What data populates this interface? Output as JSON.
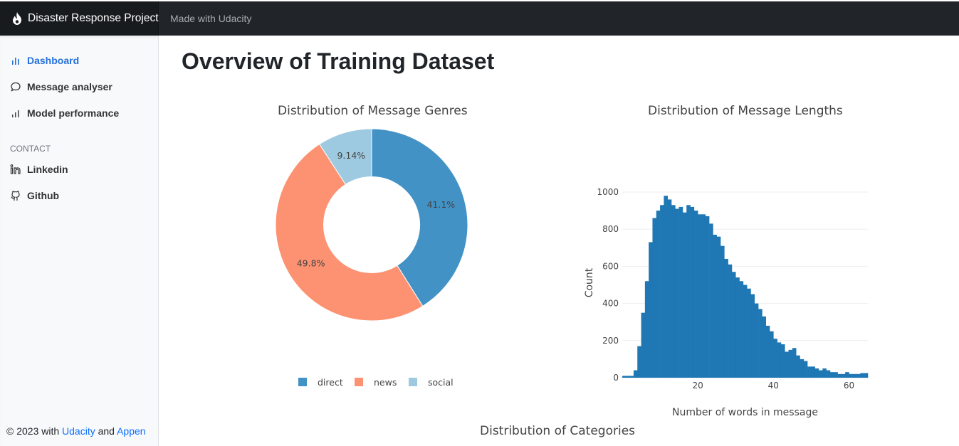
{
  "navbar": {
    "brand": "Disaster Response Project",
    "link": "Made with Udacity"
  },
  "sidebar": {
    "items": [
      {
        "label": "Dashboard",
        "icon": "bar-chart-icon",
        "active": true
      },
      {
        "label": "Message analyser",
        "icon": "chat-icon",
        "active": false
      },
      {
        "label": "Model performance",
        "icon": "bar-chart-icon",
        "active": false
      }
    ],
    "contact_heading": "CONTACT",
    "contact": [
      {
        "label": "Linkedin",
        "icon": "linkedin-icon"
      },
      {
        "label": "Github",
        "icon": "github-icon"
      }
    ],
    "footer": {
      "prefix": "© 2023 with ",
      "link1": "Udacity",
      "mid": " and ",
      "link2": "Appen"
    }
  },
  "main": {
    "title": "Overview of Training Dataset",
    "genre_chart_title": "Distribution of Message Genres",
    "length_chart_title": "Distribution of Message Lengths",
    "categories_chart_title": "Distribution of Categories"
  },
  "colors": {
    "direct": "#4292c6",
    "news": "#fc9272",
    "social": "#9ecae1",
    "hist": "#1f77b4",
    "accent": "#2470dc"
  },
  "chart_data": [
    {
      "type": "pie",
      "title": "Distribution of Message Genres",
      "hole": 0.5,
      "labels": [
        "direct",
        "news",
        "social"
      ],
      "values": [
        41.1,
        49.8,
        9.14
      ],
      "text_labels": [
        "41.1%",
        "49.8%",
        "9.14%"
      ],
      "legend": "bottom"
    },
    {
      "type": "bar",
      "title": "Distribution of Message Lengths",
      "xlabel": "Number of words in message",
      "ylabel": "Count",
      "xlim": [
        0,
        65
      ],
      "ylim": [
        0,
        1000
      ],
      "xticks": [
        20,
        40,
        60
      ],
      "yticks": [
        0,
        200,
        400,
        600,
        800,
        1000
      ],
      "bin_start": 0,
      "bin_width": 1,
      "values": [
        10,
        10,
        10,
        40,
        170,
        350,
        520,
        730,
        860,
        900,
        930,
        980,
        960,
        930,
        910,
        920,
        890,
        930,
        920,
        900,
        880,
        880,
        870,
        830,
        770,
        760,
        710,
        640,
        610,
        570,
        540,
        520,
        500,
        480,
        450,
        400,
        370,
        330,
        280,
        250,
        210,
        190,
        180,
        140,
        150,
        160,
        120,
        100,
        90,
        60,
        60,
        50,
        40,
        50,
        40,
        30,
        30,
        20,
        20,
        30,
        20,
        20,
        20,
        25,
        25
      ]
    }
  ]
}
